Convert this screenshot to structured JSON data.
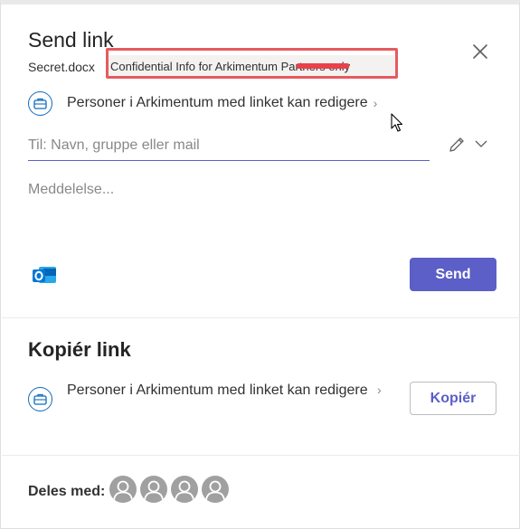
{
  "dialog": {
    "title": "Send link",
    "file_name": "Secret.docx",
    "sensitivity_label": "Confidential Info for Arkimentum Partners only",
    "permission_text": "Personer i Arkimentum med linket kan redigere",
    "to_placeholder": "Til: Navn, gruppe eller mail",
    "message_placeholder": "Meddelelse...",
    "send_label": "Send"
  },
  "copy_section": {
    "title": "Kopiér link",
    "permission_text": "Personer i Arkimentum med linket kan redigere",
    "copy_label": "Kopiér"
  },
  "shared": {
    "label": "Deles med:",
    "avatars": [
      "person-1",
      "person-2",
      "person-3",
      "person-4"
    ]
  },
  "icons": {
    "close": "close-icon",
    "briefcase": "briefcase-icon",
    "chevron": "chevron-right-icon",
    "pencil": "pencil-icon",
    "dropdown": "chevron-down-icon",
    "outlook": "outlook-icon",
    "avatar": "person-icon",
    "cursor": "mouse-cursor"
  },
  "colors": {
    "accent": "#5b5fc7",
    "briefcase_blue": "#0f6cbd",
    "highlight_red": "#e65a5f",
    "outlook_blue": "#0078d4"
  }
}
